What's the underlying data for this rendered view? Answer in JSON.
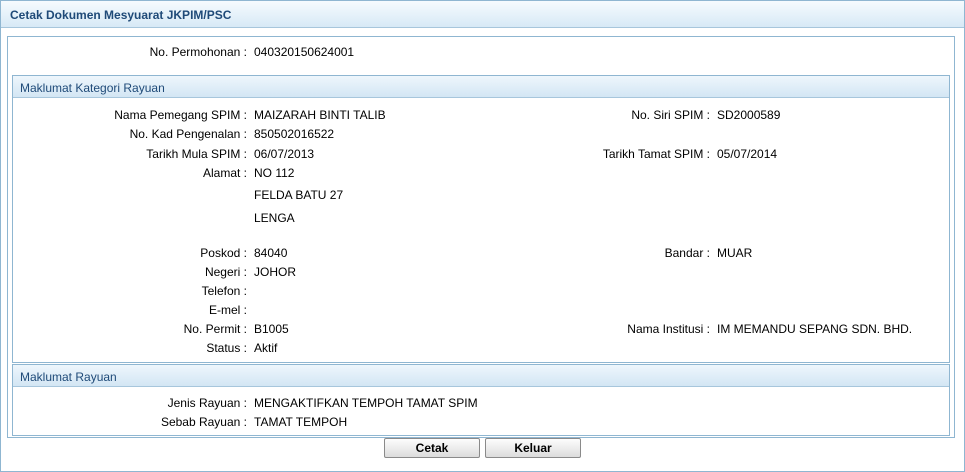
{
  "window": {
    "title": "Cetak Dokumen Mesyuarat JKPIM/PSC"
  },
  "permohonan": {
    "label": "No. Permohonan :",
    "value": "040320150624001"
  },
  "kategori": {
    "title": "Maklumat Kategori Rayuan",
    "nama_label": "Nama Pemegang SPIM :",
    "nama_value": "MAIZARAH BINTI TALIB",
    "siri_label": "No. Siri SPIM :",
    "siri_value": "SD2000589",
    "kp_label": "No. Kad Pengenalan :",
    "kp_value": "850502016522",
    "mula_label": "Tarikh Mula SPIM :",
    "mula_value": "06/07/2013",
    "tamat_label": "Tarikh Tamat SPIM :",
    "tamat_value": "05/07/2014",
    "alamat_label": "Alamat :",
    "alamat_line1": "NO 112",
    "alamat_line2": "FELDA BATU 27",
    "alamat_line3": "LENGA",
    "poskod_label": "Poskod :",
    "poskod_value": "84040",
    "bandar_label": "Bandar :",
    "bandar_value": "MUAR",
    "negeri_label": "Negeri :",
    "negeri_value": "JOHOR",
    "telefon_label": "Telefon :",
    "telefon_value": "",
    "emel_label": "E-mel :",
    "emel_value": "",
    "permit_label": "No. Permit :",
    "permit_value": "B1005",
    "institusi_label": "Nama Institusi :",
    "institusi_value": "IM MEMANDU SEPANG SDN. BHD.",
    "status_label": "Status :",
    "status_value": "Aktif"
  },
  "rayuan": {
    "title": "Maklumat Rayuan",
    "jenis_label": "Jenis Rayuan :",
    "jenis_value": "MENGAKTIFKAN TEMPOH TAMAT SPIM",
    "sebab_label": "Sebab Rayuan :",
    "sebab_value": "TAMAT TEMPOH"
  },
  "buttons": {
    "cetak": "Cetak",
    "keluar": "Keluar"
  }
}
